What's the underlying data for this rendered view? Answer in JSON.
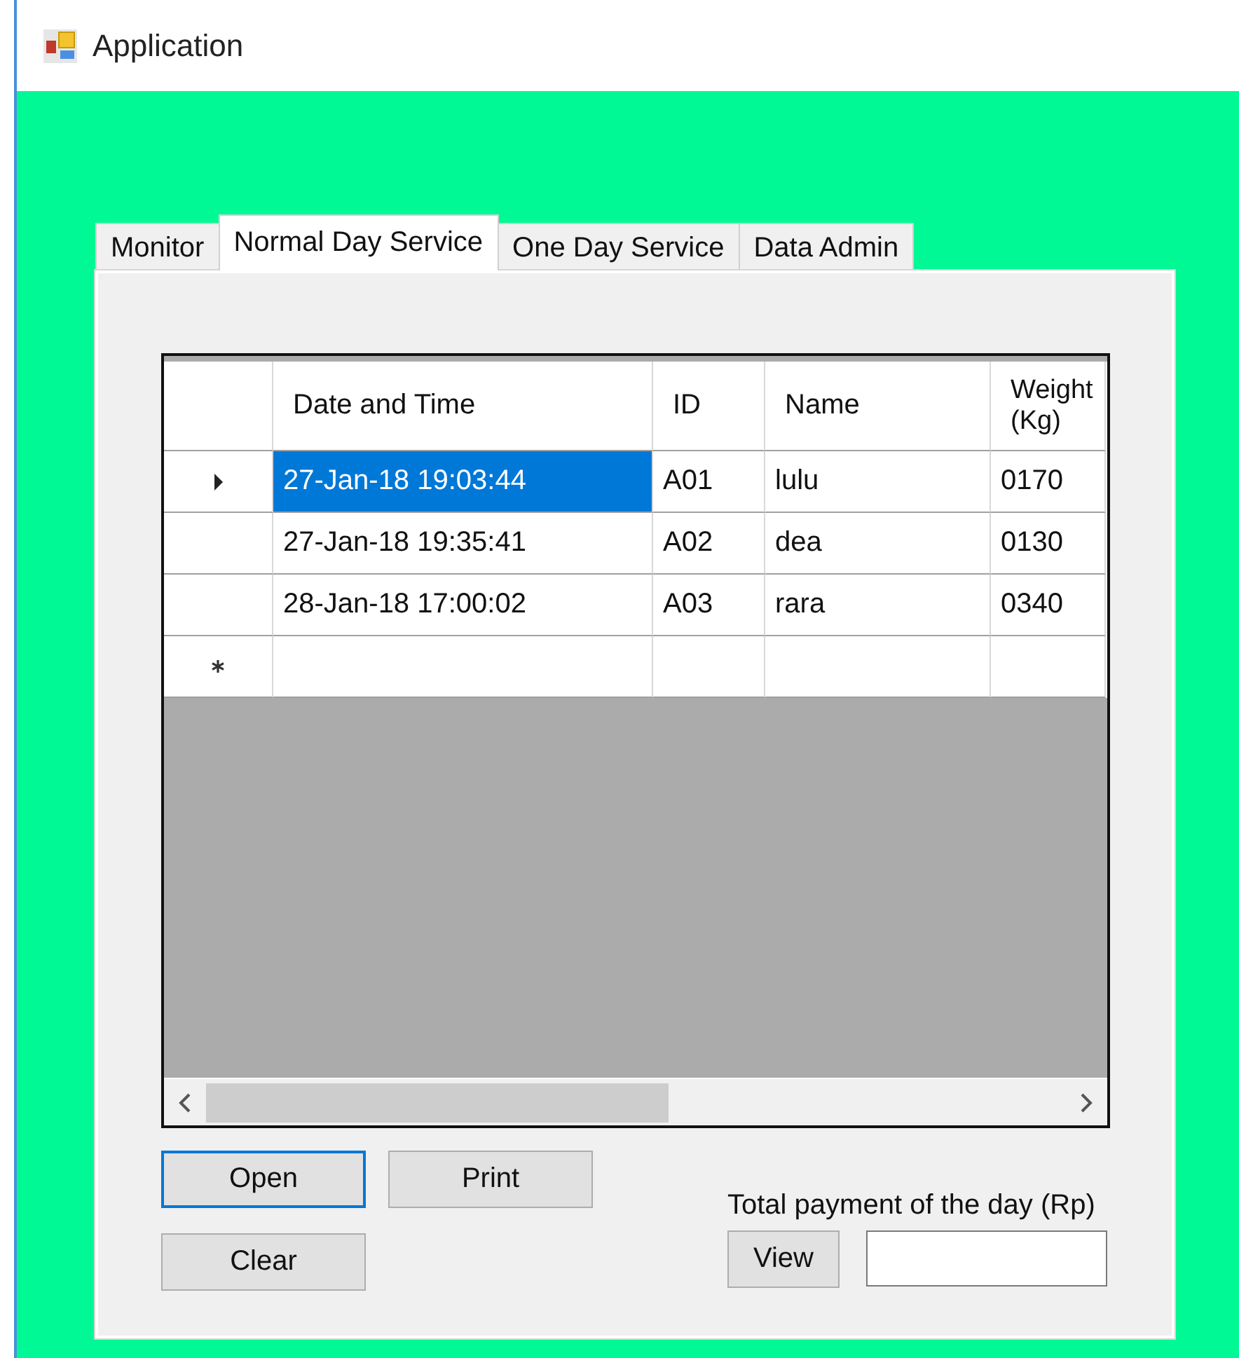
{
  "window": {
    "title": "Application"
  },
  "tabs": [
    {
      "label": "Monitor",
      "selected": false
    },
    {
      "label": "Normal Day Service",
      "selected": true
    },
    {
      "label": "One Day Service",
      "selected": false
    },
    {
      "label": "Data Admin",
      "selected": false
    }
  ],
  "table": {
    "columns": [
      "Date and Time",
      "ID",
      "Name",
      "Weight (Kg)"
    ],
    "rows": [
      {
        "kind": "current",
        "cells": [
          {
            "text": "27-Jan-18 19:03:44",
            "selected": true
          },
          {
            "text": "A01",
            "selected": false
          },
          {
            "text": "lulu",
            "selected": false
          },
          {
            "text": "0170",
            "selected": false
          }
        ]
      },
      {
        "kind": "data",
        "cells": [
          {
            "text": "27-Jan-18 19:35:41",
            "selected": false
          },
          {
            "text": "A02",
            "selected": false
          },
          {
            "text": "dea",
            "selected": false
          },
          {
            "text": "0130",
            "selected": false
          }
        ]
      },
      {
        "kind": "data",
        "cells": [
          {
            "text": "28-Jan-18 17:00:02",
            "selected": false
          },
          {
            "text": "A03",
            "selected": false
          },
          {
            "text": "rara",
            "selected": false
          },
          {
            "text": "0340",
            "selected": false
          }
        ]
      },
      {
        "kind": "new"
      }
    ]
  },
  "buttons": [
    {
      "label": "Open",
      "focused": true
    },
    {
      "label": "Print",
      "focused": false
    },
    {
      "label": "Clear",
      "focused": false
    }
  ],
  "payment": {
    "label": "Total payment of the day (Rp)",
    "button": "View"
  }
}
